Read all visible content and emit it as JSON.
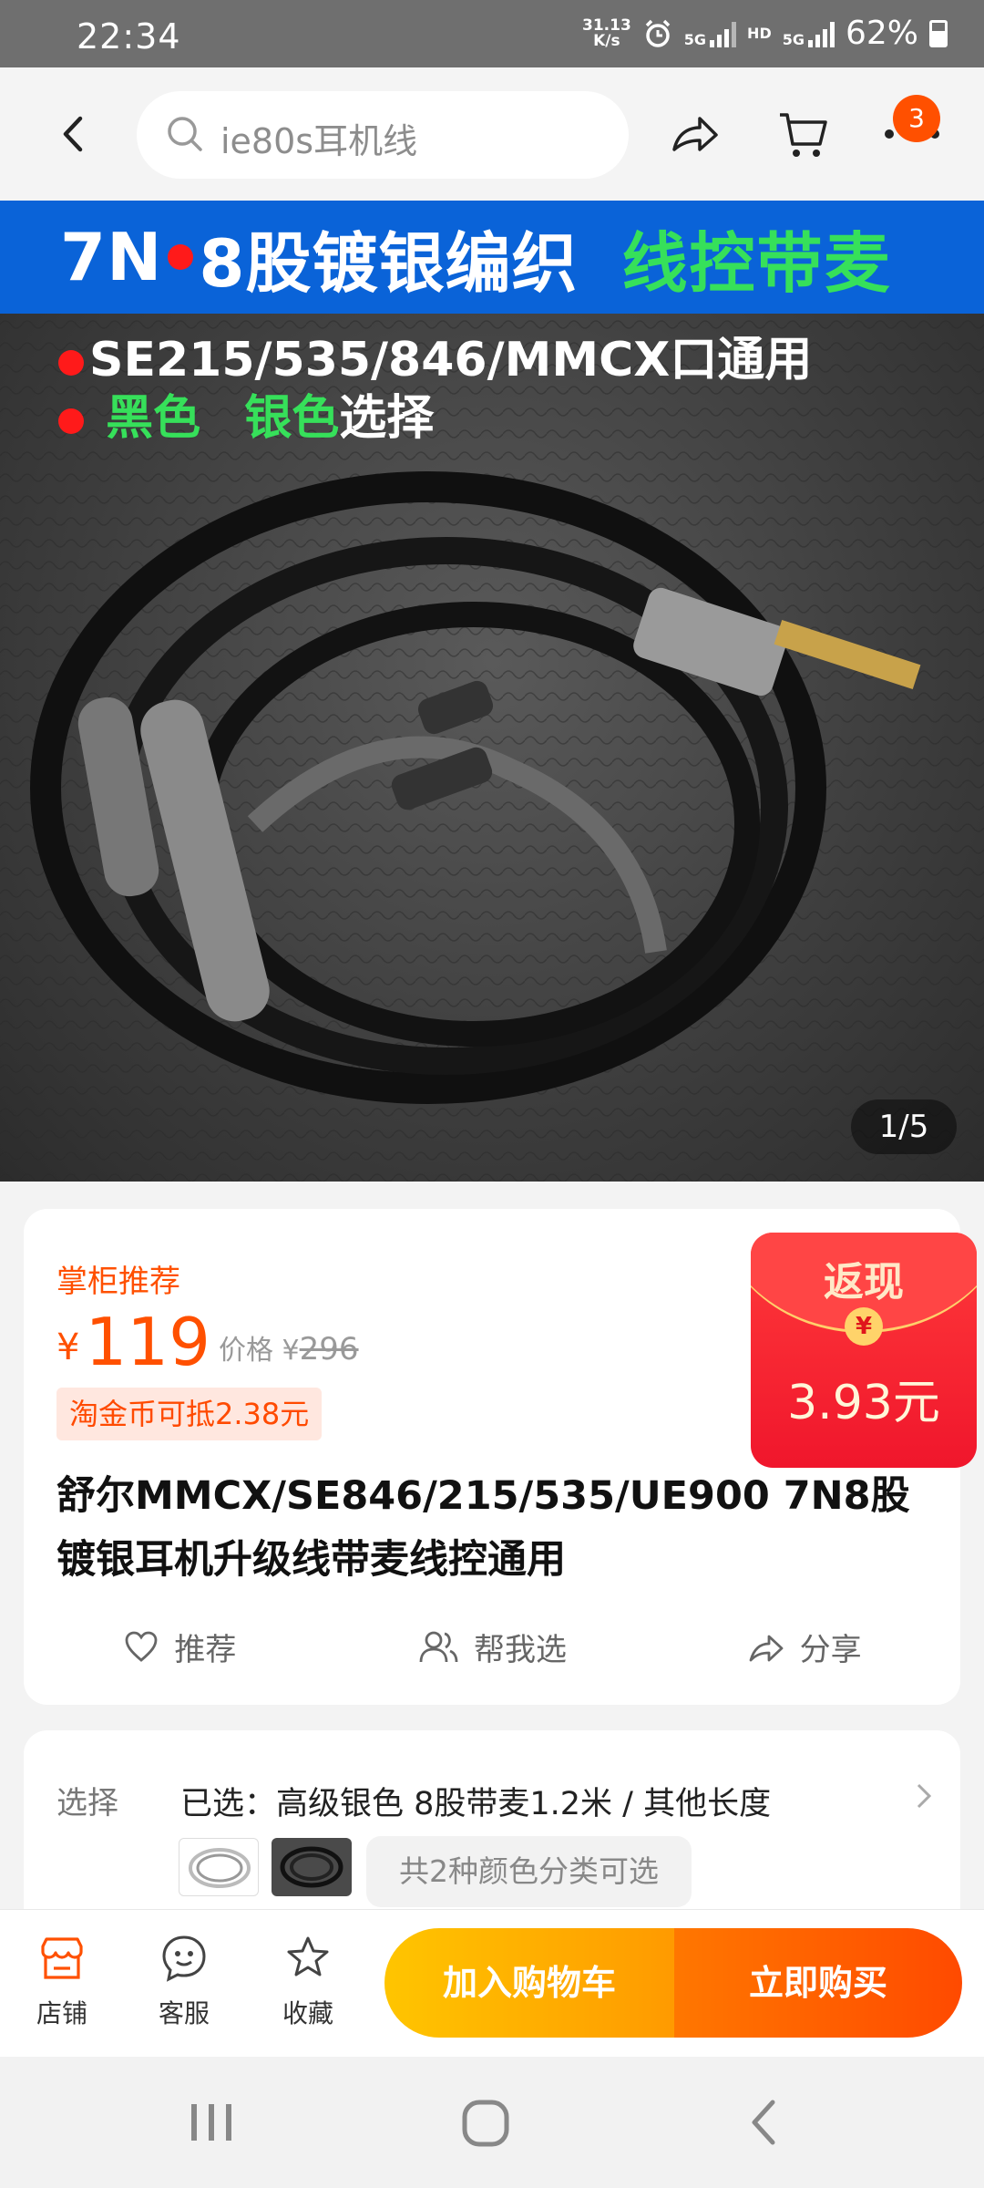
{
  "status_bar": {
    "time": "22:34",
    "net_speed_value": "31.13",
    "net_speed_unit": "K/s",
    "network_1": "5G",
    "hd_label": "HD",
    "network_2": "5G",
    "battery": "62%"
  },
  "header": {
    "search_placeholder": "ie80s耳机线",
    "cart_badge": "3"
  },
  "hero": {
    "banner_left_a": "7N",
    "banner_left_b": "8股镀银编织",
    "banner_right": "线控带麦",
    "line1": "SE215/535/846/MMCX口通用",
    "line2_black": "黑色",
    "line2_silver": "银色",
    "line2_suffix": "选择",
    "counter": "1/5"
  },
  "product": {
    "recommend": "掌柜推荐",
    "currency": "¥",
    "price": "119",
    "orig_label": "价格",
    "orig_price": "296",
    "coin_text": "淘金币可抵2.38元",
    "title": "舒尔MMCX/SE846/215/535/UE900 7N8股镀银耳机升级线带麦线控通用",
    "actions": {
      "recommend": "推荐",
      "help_choose": "帮我选",
      "share": "分享"
    }
  },
  "cashback": {
    "label": "返现",
    "coin": "¥",
    "amount": "3.93元"
  },
  "selection": {
    "label": "选择",
    "value": "已选：高级银色 8股带麦1.2米 / 其他长度",
    "more": "共2种颜色分类可选"
  },
  "bottom_bar": {
    "shop": "店铺",
    "service": "客服",
    "favorite": "收藏",
    "add_to_cart": "加入购物车",
    "buy_now": "立即购买"
  },
  "colors": {
    "accent": "#ff5000",
    "banner_blue": "#0a63d8",
    "highlight_green": "#36e05a",
    "cashback_red": "#f0162c"
  }
}
